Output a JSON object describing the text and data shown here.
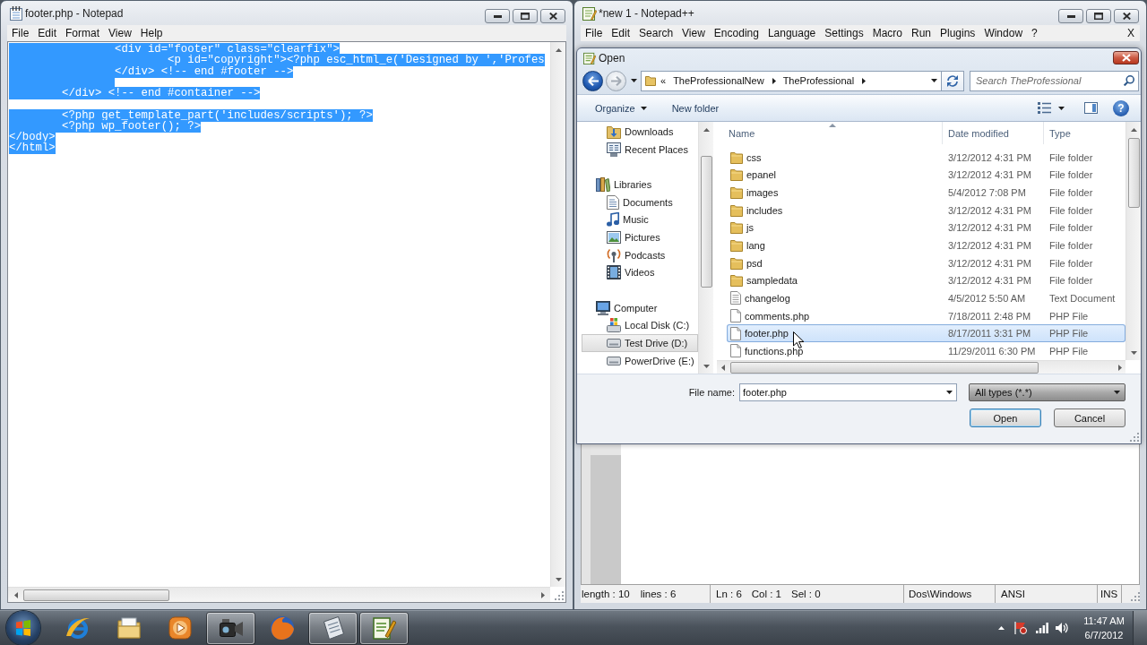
{
  "notepad": {
    "title": "footer.php - Notepad",
    "menu": [
      "File",
      "Edit",
      "Format",
      "View",
      "Help"
    ],
    "lines": [
      {
        "kind": "code",
        "text": "\t\t<div id=\"footer\" class=\"clearfix\">",
        "selected": true
      },
      {
        "kind": "code",
        "text": "\t\t\t<p id=\"copyright\"><?php esc_html_e('Designed by ','Profes",
        "selected": true
      },
      {
        "kind": "code",
        "text": "\t\t</div> <!-- end #footer -->",
        "selected": true
      },
      {
        "kind": "blank",
        "selected": true
      },
      {
        "kind": "code",
        "text": "\t</div> <!-- end #container -->",
        "selected": true
      },
      {
        "kind": "blank"
      },
      {
        "kind": "code",
        "text": "\t<?php get_template_part('includes/scripts'); ?>",
        "selected": true
      },
      {
        "kind": "code",
        "text": "\t<?php wp_footer(); ?>",
        "selected": true
      },
      {
        "kind": "code",
        "text": "</body>",
        "selected": true
      },
      {
        "kind": "code",
        "text": "</html>",
        "selected": true
      }
    ]
  },
  "notepad_plus": {
    "title": "*new 1 - Notepad++",
    "menu": [
      "File",
      "Edit",
      "Search",
      "View",
      "Encoding",
      "Language",
      "Settings",
      "Macro",
      "Run",
      "Plugins",
      "Window",
      "?"
    ],
    "close_document": "X",
    "status_bar": [
      [
        "length : 10",
        "lines : 6"
      ],
      [
        "Ln : 6",
        "Col : 1",
        "Sel : 0"
      ],
      [
        "Dos\\Windows"
      ],
      [
        "ANSI"
      ],
      [
        "INS"
      ]
    ]
  },
  "open_dialog": {
    "title": "Open",
    "address": {
      "overflow": "«",
      "path": [
        "TheProfessionalNew",
        "TheProfessional"
      ]
    },
    "search": {
      "placeholder": "Search TheProfessional"
    },
    "toolbar": [
      {
        "label": "Organize",
        "kind": "menu"
      },
      {
        "label": "New folder",
        "kind": "button"
      }
    ],
    "help_button": "?",
    "navigation": [
      {
        "children": [
          {
            "label": "Downloads",
            "kind": "downloads",
            "selected": false
          },
          {
            "label": "Recent Places",
            "kind": "recent",
            "selected": false
          }
        ]
      },
      {
        "label": "Libraries",
        "kind": "libraries",
        "selected": false,
        "children": [
          {
            "label": "Documents",
            "kind": "documents",
            "selected": false
          },
          {
            "label": "Music",
            "kind": "music",
            "selected": false
          },
          {
            "label": "Pictures",
            "kind": "pictures",
            "selected": false
          },
          {
            "label": "Podcasts",
            "kind": "podcasts",
            "selected": false
          },
          {
            "label": "Videos",
            "kind": "videos",
            "selected": false
          }
        ]
      },
      {
        "label": "Computer",
        "kind": "computer",
        "selected": false,
        "children": [
          {
            "label": "Local Disk (C:)",
            "kind": "system-disk",
            "selected": false
          },
          {
            "label": "Test Drive (D:)",
            "kind": "drive",
            "selected": true
          },
          {
            "label": "PowerDrive (E:)",
            "kind": "drive",
            "selected": false
          }
        ]
      }
    ],
    "columns": [
      {
        "label": "Name",
        "sorted": true
      },
      {
        "label": "Date modified",
        "sorted": false
      },
      {
        "label": "Type",
        "sorted": false
      }
    ],
    "files": [
      {
        "name": "css",
        "date": "3/12/2012 4:31 PM",
        "type": "File folder",
        "kind": "folder",
        "selected": false
      },
      {
        "name": "epanel",
        "date": "3/12/2012 4:31 PM",
        "type": "File folder",
        "kind": "folder",
        "selected": false
      },
      {
        "name": "images",
        "date": "5/4/2012 7:08 PM",
        "type": "File folder",
        "kind": "folder",
        "selected": false
      },
      {
        "name": "includes",
        "date": "3/12/2012 4:31 PM",
        "type": "File folder",
        "kind": "folder",
        "selected": false
      },
      {
        "name": "js",
        "date": "3/12/2012 4:31 PM",
        "type": "File folder",
        "kind": "folder",
        "selected": false
      },
      {
        "name": "lang",
        "date": "3/12/2012 4:31 PM",
        "type": "File folder",
        "kind": "folder",
        "selected": false
      },
      {
        "name": "psd",
        "date": "3/12/2012 4:31 PM",
        "type": "File folder",
        "kind": "folder",
        "selected": false
      },
      {
        "name": "sampledata",
        "date": "3/12/2012 4:31 PM",
        "type": "File folder",
        "kind": "folder",
        "selected": false
      },
      {
        "name": "changelog",
        "date": "4/5/2012 5:50 AM",
        "type": "Text Document",
        "kind": "document",
        "selected": false
      },
      {
        "name": "comments.php",
        "date": "7/18/2011 2:48 PM",
        "type": "PHP File",
        "kind": "file",
        "selected": false
      },
      {
        "name": "footer.php",
        "date": "8/17/2011 3:31 PM",
        "type": "PHP File",
        "kind": "file",
        "selected": true
      },
      {
        "name": "functions.php",
        "date": "11/29/2011 6:30 PM",
        "type": "PHP File",
        "kind": "file",
        "selected": false
      }
    ],
    "file_name": {
      "label": "File name:",
      "value": "footer.php"
    },
    "file_type": "All types (*.*)",
    "buttons": [
      {
        "label": "Open",
        "default": true
      },
      {
        "label": "Cancel",
        "default": false
      }
    ]
  },
  "taskbar": {
    "apps": [
      {
        "kind": "browser",
        "running": false
      },
      {
        "kind": "folders",
        "running": false
      },
      {
        "kind": "player",
        "running": false
      },
      {
        "kind": "camcorder",
        "running": true
      },
      {
        "kind": "globe",
        "running": false
      },
      {
        "kind": "notepad",
        "running": true
      },
      {
        "kind": "editor",
        "running": true
      }
    ],
    "clock": {
      "time": "11:47 AM",
      "date": "6/7/2012"
    }
  }
}
